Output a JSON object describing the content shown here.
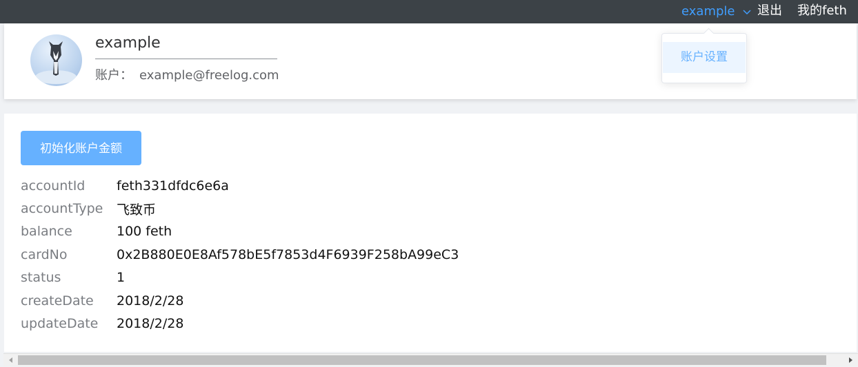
{
  "header": {
    "username": "example",
    "logout_label": "退出",
    "my_feth_label": "我的feth"
  },
  "dropdown": {
    "items": [
      {
        "label": "账户设置"
      }
    ]
  },
  "profile": {
    "username": "example",
    "account_label": "账户：",
    "account_value": "example@freelog.com"
  },
  "main": {
    "init_button_label": "初始化账户金额",
    "info": [
      {
        "key": "accountId",
        "value": "feth331dfdc6e6a"
      },
      {
        "key": "accountType",
        "value": "飞致币"
      },
      {
        "key": "balance",
        "value": "100 feth"
      },
      {
        "key": "cardNo",
        "value": "0x2B880E0E8Af578bE5f7853d4F6939F258bA99eC3"
      },
      {
        "key": "status",
        "value": "1"
      },
      {
        "key": "createDate",
        "value": "2018/2/28"
      },
      {
        "key": "updateDate",
        "value": "2018/2/28"
      }
    ]
  },
  "colors": {
    "topbar": "#3c4247",
    "accent": "#409eff",
    "button": "#66b1ff"
  }
}
